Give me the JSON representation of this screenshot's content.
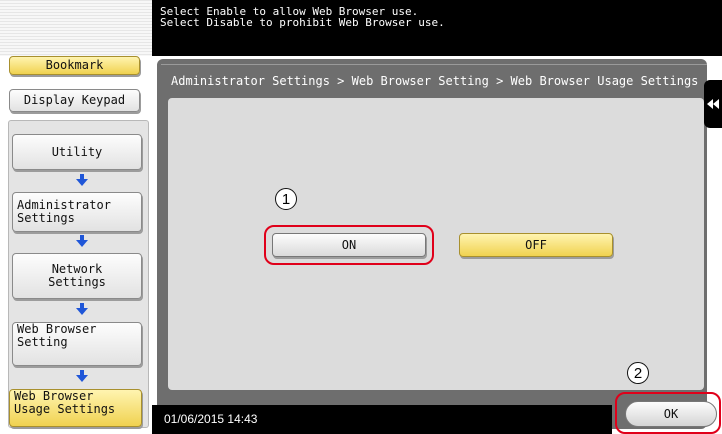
{
  "message": {
    "line1": "Select Enable to allow Web Browser use.",
    "line2": "Select Disable to prohibit Web Browser use."
  },
  "sidebar": {
    "bookmark_label": "Bookmark",
    "display_keypad_label": "Display Keypad",
    "breadcrumbs": [
      {
        "label": "Utility"
      },
      {
        "label_line1": "Administrator",
        "label_line2": "Settings"
      },
      {
        "label_line1": "Network",
        "label_line2": "Settings"
      },
      {
        "label_line1": "Web Browser",
        "label_line2": "Setting"
      },
      {
        "label_line1": "Web Browser",
        "label_line2": "Usage Settings"
      }
    ]
  },
  "main": {
    "path": "Administrator Settings > Web Browser Setting > Web Browser Usage Settings",
    "options": {
      "on_label": "ON",
      "off_label": "OFF",
      "selected": "OFF"
    },
    "ok_label": "OK",
    "status_datetime": "01/06/2015  14:43"
  },
  "callouts": {
    "one": "1",
    "two": "2"
  },
  "colors": {
    "highlight": "#e0001a",
    "selected_yellow": "#f0d250",
    "panel_gray": "#6e6e6e"
  }
}
